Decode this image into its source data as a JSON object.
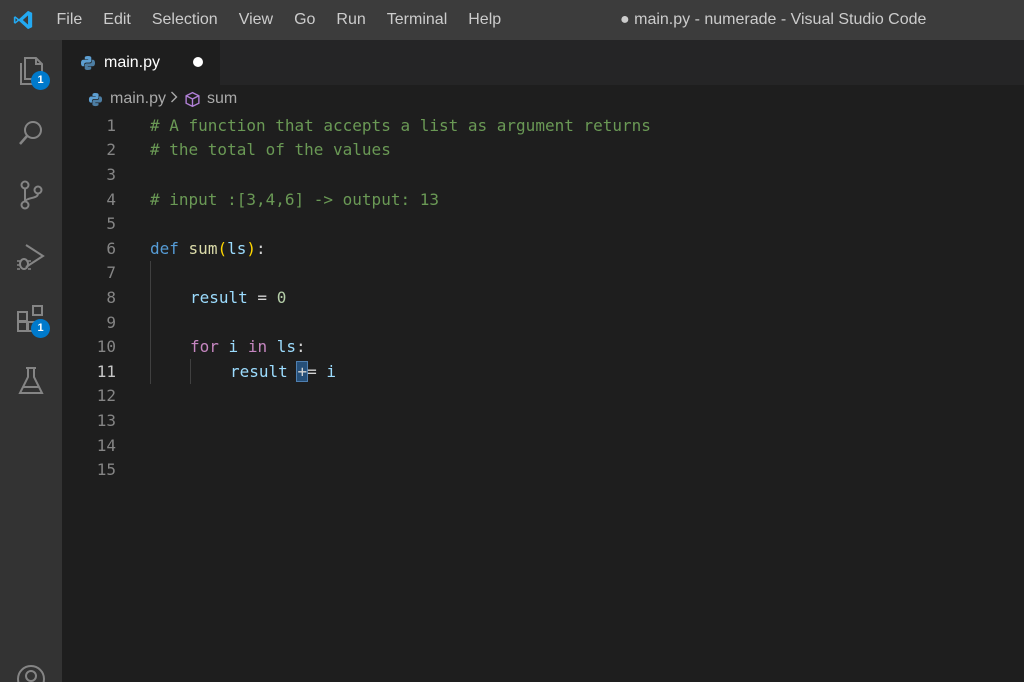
{
  "window_title": "● main.py - numerade - Visual Studio Code",
  "menu": [
    "File",
    "Edit",
    "Selection",
    "View",
    "Go",
    "Run",
    "Terminal",
    "Help"
  ],
  "activity_bar": {
    "explorer_badge": "1",
    "extensions_badge": "1"
  },
  "tab": {
    "label": "main.py",
    "modified": true
  },
  "breadcrumb": {
    "file": "main.py",
    "symbol": "sum"
  },
  "editor": {
    "active_line": 11,
    "line_numbers": [
      "1",
      "2",
      "3",
      "4",
      "5",
      "6",
      "7",
      "8",
      "9",
      "10",
      "11",
      "12",
      "13",
      "14",
      "15"
    ],
    "lines": {
      "l1": "# A function that accepts a list as argument returns",
      "l2": "# the total of the values",
      "l4": "# input :[3,4,6] -> output: 13",
      "l6_kw": "def",
      "l6_fn": "sum",
      "l6_open": "(",
      "l6_arg": "ls",
      "l6_close": ")",
      "l6_colon": ":",
      "l8_var": "result",
      "l8_op": " = ",
      "l8_num": "0",
      "l10_for": "for",
      "l10_i": "i",
      "l10_in": "in",
      "l10_ls": "ls",
      "l10_colon": ":",
      "l11_var": "result",
      "l11_cursor": "+",
      "l11_op": "= ",
      "l11_i": "i"
    }
  },
  "colors": {
    "accent": "#007acc",
    "comment": "#6a9955",
    "keyword": "#569cd6",
    "control": "#c586c0",
    "function": "#dcdcaa",
    "variable": "#9cdcfe",
    "number": "#b5cea8"
  }
}
